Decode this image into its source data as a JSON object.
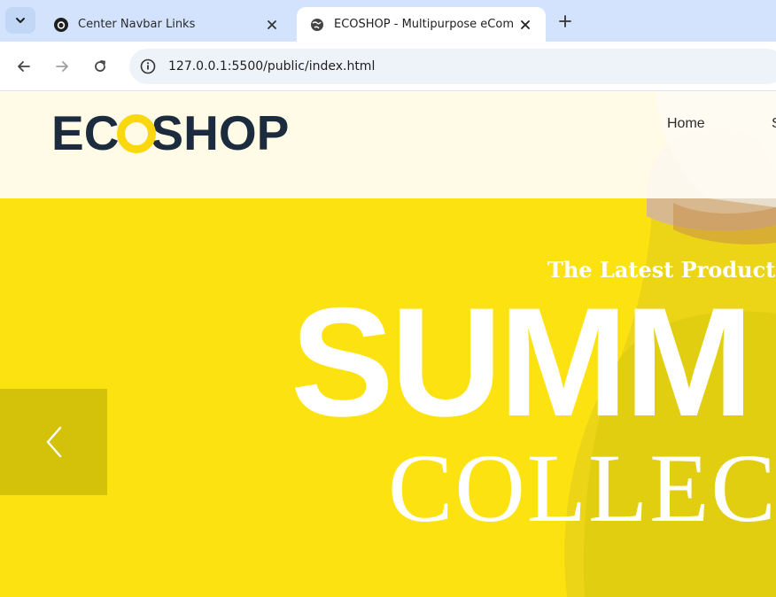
{
  "browser": {
    "tabs": [
      {
        "title": "Center Navbar Links",
        "favicon": "github-icon",
        "active": false
      },
      {
        "title": "ECOSHOP - Multipurpose eCom",
        "favicon": "globe-icon",
        "active": true
      }
    ],
    "address_bar": {
      "url": "127.0.0.1:5500/public/index.html"
    }
  },
  "site": {
    "logo": {
      "prefix": "E",
      "c_letter": "C",
      "suffix": "SHOP"
    },
    "nav": [
      {
        "label": "Home"
      },
      {
        "label": "S"
      }
    ],
    "hero": {
      "tagline": "The Latest Product fro",
      "title": "SUMM",
      "subtitle": "COLLEC",
      "prev_icon": "chevron-left-icon"
    },
    "colors": {
      "brand_yellow": "#fde211",
      "brand_dark": "#1d2b3e",
      "header_bg": "#fffcf4"
    }
  }
}
